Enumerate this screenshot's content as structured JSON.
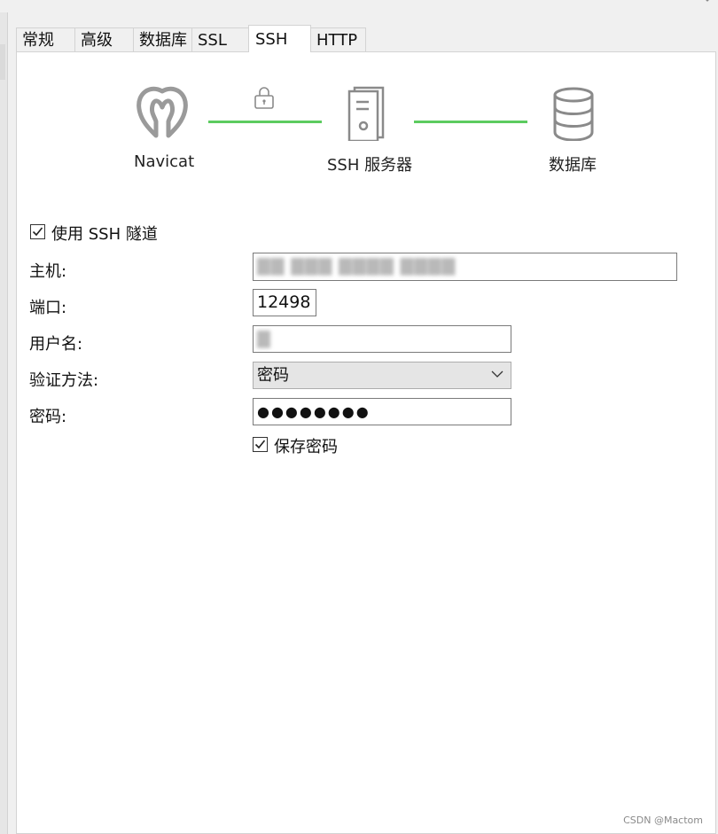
{
  "tabs": [
    {
      "label": "常规",
      "active": false
    },
    {
      "label": "高级",
      "active": false
    },
    {
      "label": "数据库",
      "active": false
    },
    {
      "label": "SSL",
      "active": false
    },
    {
      "label": "SSH",
      "active": true
    },
    {
      "label": "HTTP",
      "active": false
    }
  ],
  "diagram": {
    "client_label": "Navicat",
    "server_label": "SSH 服务器",
    "db_label": "数据库",
    "lock_icon": "lock-icon",
    "link_color": "#5ccb5f"
  },
  "form": {
    "use_ssh_label": "使用 SSH 隧道",
    "use_ssh_checked": true,
    "host_label": "主机:",
    "host_value": "▇▇ ▇▇▇ ▇▇▇▇ ▇▇▇▇",
    "port_label": "端口:",
    "port_value": "12498",
    "user_label": "用户名:",
    "user_value": "▇",
    "auth_label": "验证方法:",
    "auth_value": "密码",
    "password_label": "密码:",
    "password_value": "●●●●●●●●",
    "save_password_label": "保存密码",
    "save_password_checked": true
  },
  "watermark": "CSDN @Mactom"
}
